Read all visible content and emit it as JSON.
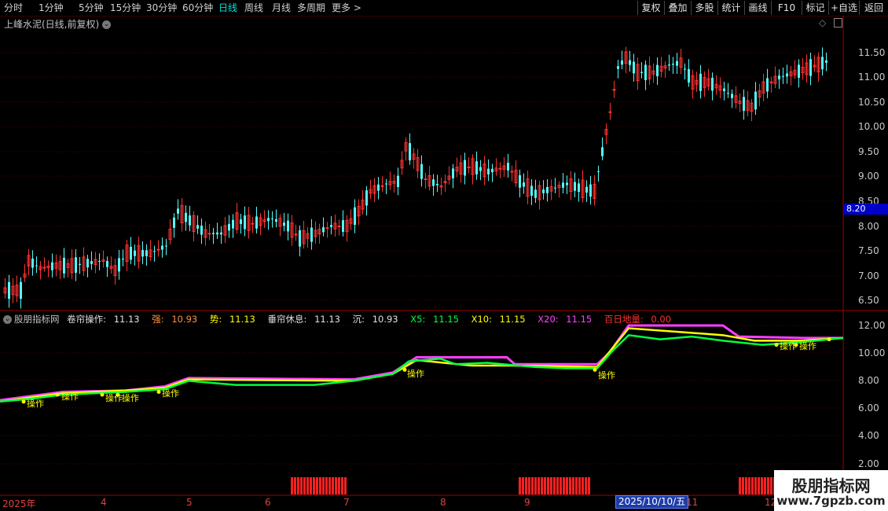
{
  "toolbar": {
    "periods": [
      "分时",
      "1分钟",
      "5分钟",
      "15分钟",
      "30分钟",
      "60分钟",
      "日线",
      "周线",
      "月线",
      "多周期",
      "更多 >"
    ],
    "active_period": "日线",
    "right_buttons": [
      "复权",
      "叠加",
      "多股",
      "统计",
      "画线",
      "F10",
      "标记",
      "+自选",
      "返回"
    ]
  },
  "chart_title": "上峰水泥(日线,前复权)",
  "price_axis": [
    "11.50",
    "11.00",
    "10.50",
    "10.00",
    "9.50",
    "9.00",
    "8.50",
    "8.00",
    "7.50",
    "7.00",
    "6.50"
  ],
  "current_price_tag": "8.20",
  "indicator": {
    "name": "股朋指标网",
    "items": [
      {
        "label": "卷帘操作:",
        "value": "11.13",
        "color": "#e0e0e0"
      },
      {
        "label": "强:",
        "value": "10.93",
        "color": "#ff9040"
      },
      {
        "label": "势:",
        "value": "11.13",
        "color": "#ffff00"
      },
      {
        "label": "垂帘休息:",
        "value": "11.13",
        "color": "#e0e0e0"
      },
      {
        "label": "沉:",
        "value": "10.93",
        "color": "#e0e0e0"
      },
      {
        "label": "X5:",
        "value": "11.15",
        "color": "#00ff40"
      },
      {
        "label": "X10:",
        "value": "11.15",
        "color": "#ffff00"
      },
      {
        "label": "X20:",
        "value": "11.15",
        "color": "#ff40ff"
      },
      {
        "label": "百日地量:",
        "value": "0.00",
        "color": "#ff3030"
      }
    ],
    "axis": [
      "12.00",
      "10.00",
      "8.00",
      "6.00",
      "4.00",
      "2.00"
    ],
    "signal_label": "操作"
  },
  "date_axis": {
    "labels": [
      "2025年",
      "4",
      "5",
      "6",
      "7",
      "8",
      "9",
      "11",
      "12"
    ],
    "selected": "2025/10/10/五"
  },
  "watermark": {
    "title": "股朋指标网",
    "url": "www.7gpzb.com"
  },
  "colors": {
    "up": "#ff3232",
    "down": "#54fcfc",
    "grid": "#5a0000",
    "x5": "#00ff40",
    "x10": "#ffff00",
    "x20": "#ff40ff"
  }
}
